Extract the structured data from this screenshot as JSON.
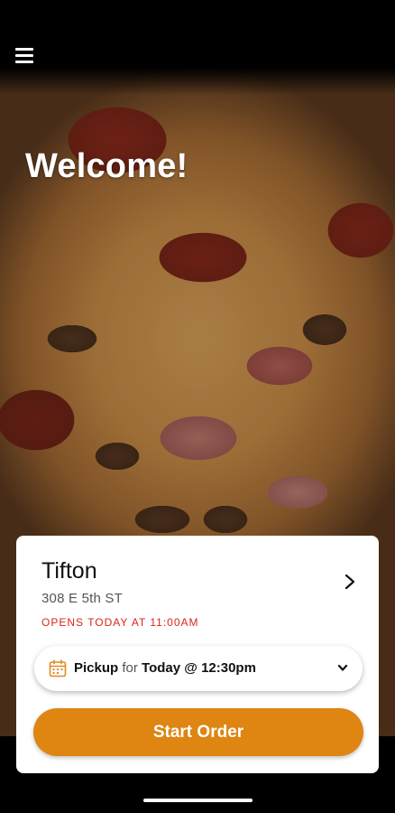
{
  "header": {
    "menu_icon": "hamburger-menu-icon"
  },
  "hero": {
    "welcome": "Welcome!",
    "image": "pizza-photo"
  },
  "location": {
    "name": "Tifton",
    "address": "308 E 5th ST",
    "hours": "OPENS TODAY AT 11:00AM"
  },
  "pickup": {
    "icon": "calendar-icon",
    "mode": "Pickup",
    "connector": "for",
    "time": "Today @ 12:30pm"
  },
  "actions": {
    "start_order": "Start Order"
  },
  "colors": {
    "accent": "#de8512",
    "hours_red": "#d9251c",
    "calendar_orange": "#e08a1e"
  }
}
